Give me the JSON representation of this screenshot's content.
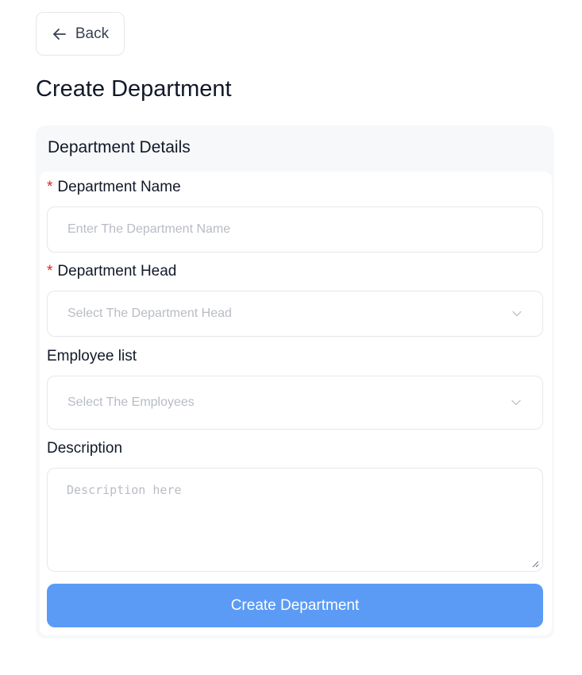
{
  "back": {
    "label": "Back",
    "icon": "arrow-left-icon"
  },
  "page": {
    "title": "Create Department"
  },
  "card": {
    "title": "Department Details"
  },
  "form": {
    "name": {
      "required_mark": "*",
      "label": "Department Name",
      "placeholder": "Enter The Department Name",
      "value": ""
    },
    "head": {
      "required_mark": "*",
      "label": "Department Head",
      "placeholder": "Select The Department Head",
      "icon": "chevron-down-icon"
    },
    "employees": {
      "label": "Employee list",
      "placeholder": "Select The Employees",
      "icon": "chevron-down-icon"
    },
    "description": {
      "label": "Description",
      "placeholder": "Description here",
      "value": ""
    },
    "submit_label": "Create Department"
  },
  "colors": {
    "accent": "#5b9bf6",
    "required": "#dc2626",
    "placeholder": "#b8bcc4",
    "card_bg": "#f7f8fa"
  }
}
